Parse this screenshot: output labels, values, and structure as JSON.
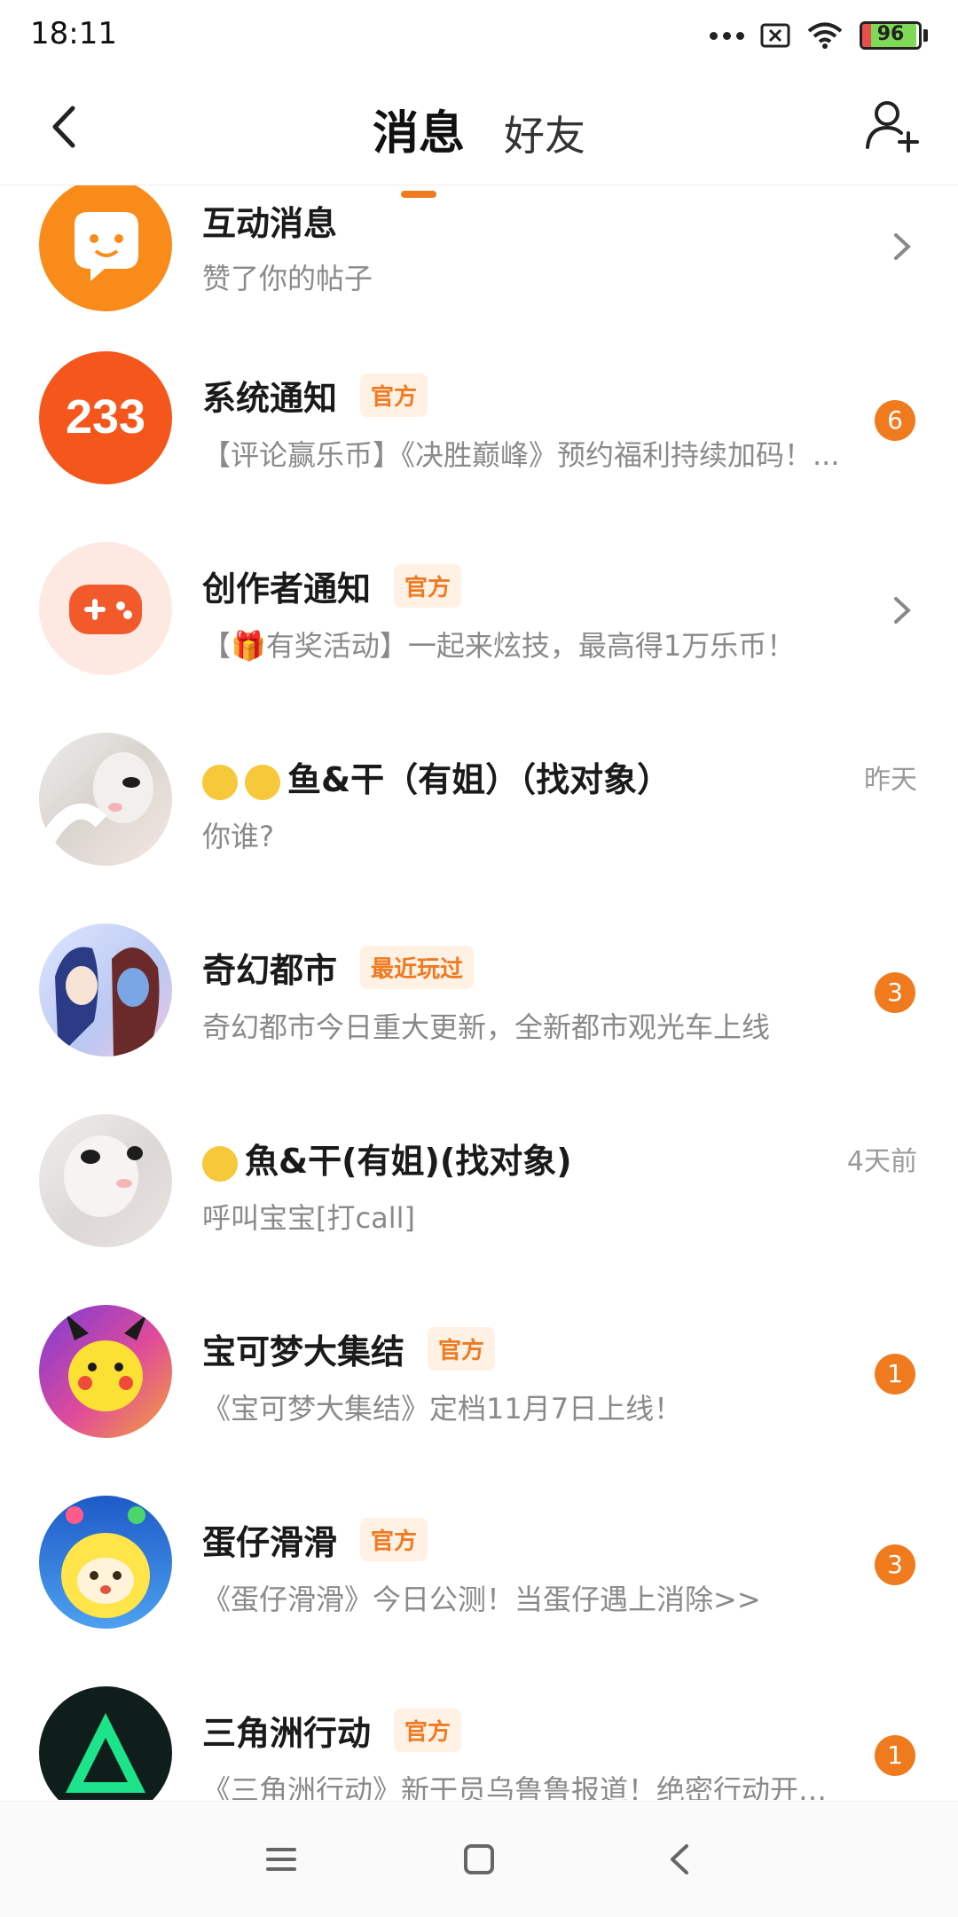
{
  "status_bar": {
    "time": "18:11",
    "battery_level": "96",
    "icons": [
      "more-dots-icon",
      "no-sim-icon",
      "wifi-icon",
      "battery-icon"
    ]
  },
  "header": {
    "tabs": [
      {
        "label": "消息",
        "active": true
      },
      {
        "label": "好友",
        "active": false
      }
    ],
    "accent_color": "#f07a1e",
    "icons": [
      "back-icon",
      "add-friend-icon"
    ]
  },
  "messages": [
    {
      "title": "互动消息",
      "subtitle": "赞了你的帖子",
      "badge": "",
      "time": "",
      "count": "",
      "chevron": true,
      "avatar": "chat-bubble-icon"
    },
    {
      "title": "系统通知",
      "subtitle": "【评论赢乐币】《决胜巅峰》预约福利持续加码！...",
      "badge": "官方",
      "time": "",
      "count": "6",
      "chevron": false,
      "avatar_text": "233"
    },
    {
      "title": "创作者通知",
      "subtitle": "【🎁有奖活动】一起来炫技，最高得1万乐币！",
      "badge": "官方",
      "time": "",
      "count": "",
      "chevron": true,
      "avatar": "gamepad-icon"
    },
    {
      "title": "鱼&干（有姐）（找对象）",
      "subtitle": "你谁?",
      "badge": "",
      "time": "昨天",
      "count": "",
      "chevron": false,
      "avatar": "anime-avatar"
    },
    {
      "title": "奇幻都市",
      "subtitle": "奇幻都市今日重大更新，全新都市观光车上线",
      "badge": "最近玩过",
      "time": "",
      "count": "3",
      "chevron": false,
      "avatar": "game-avatar"
    },
    {
      "title": "魚&干(有姐)(找对象)",
      "subtitle": "呼叫宝宝[打call]",
      "badge": "",
      "time": "4天前",
      "count": "",
      "chevron": false,
      "avatar": "anime-avatar"
    },
    {
      "title": "宝可梦大集结",
      "subtitle": "《宝可梦大集结》定档11月7日上线！",
      "badge": "官方",
      "time": "",
      "count": "1",
      "chevron": false,
      "avatar": "pikachu-avatar"
    },
    {
      "title": "蛋仔滑滑",
      "subtitle": "《蛋仔滑滑》今日公测！当蛋仔遇上消除>>",
      "badge": "官方",
      "time": "",
      "count": "3",
      "chevron": false,
      "avatar": "eggy-avatar"
    },
    {
      "title": "三角洲行动",
      "subtitle": "《三角洲行动》新干员乌鲁鲁报道！绝密行动开启！",
      "badge": "官方",
      "time": "",
      "count": "1",
      "chevron": false,
      "avatar": "delta-avatar"
    }
  ],
  "nav_bar": {
    "icons": [
      "menu-icon",
      "home-icon",
      "back-nav-icon"
    ]
  }
}
